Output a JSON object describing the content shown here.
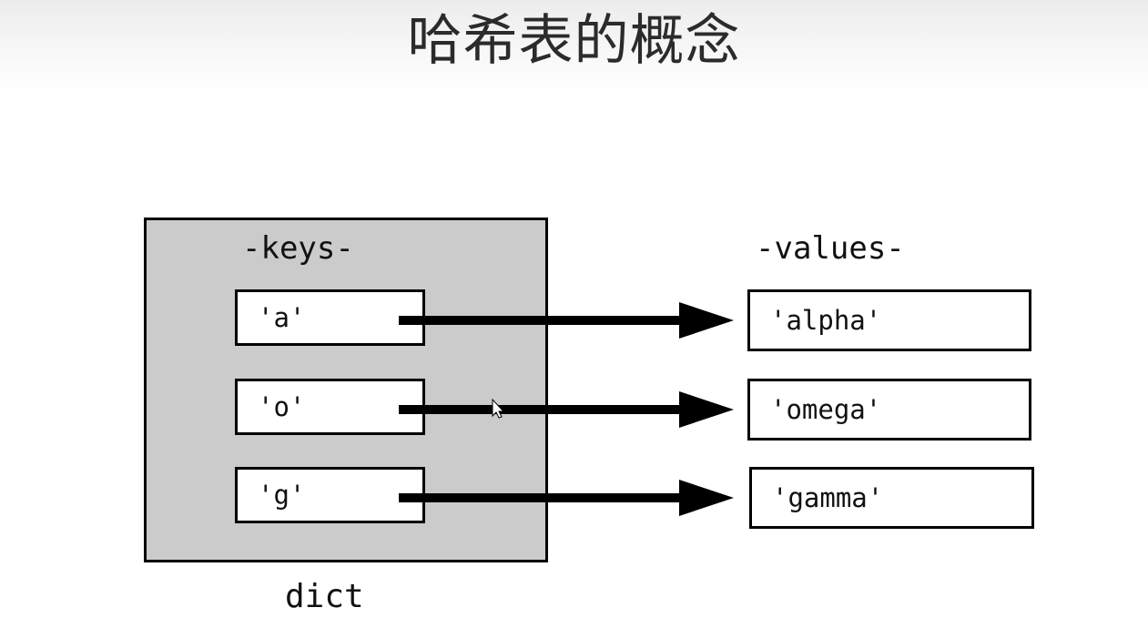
{
  "title": "哈希表的概念",
  "diagram": {
    "keys_heading": "-keys-",
    "values_heading": "-values-",
    "container_label": "dict",
    "keys": [
      "'a'",
      "'o'",
      "'g'"
    ],
    "values": [
      "'alpha'",
      "'omega'",
      "'gamma'"
    ]
  },
  "colors": {
    "dict_fill": "#cbcbcb",
    "box_border": "#000000",
    "arrow": "#000000"
  },
  "icons": [
    "mouse-cursor-icon"
  ]
}
